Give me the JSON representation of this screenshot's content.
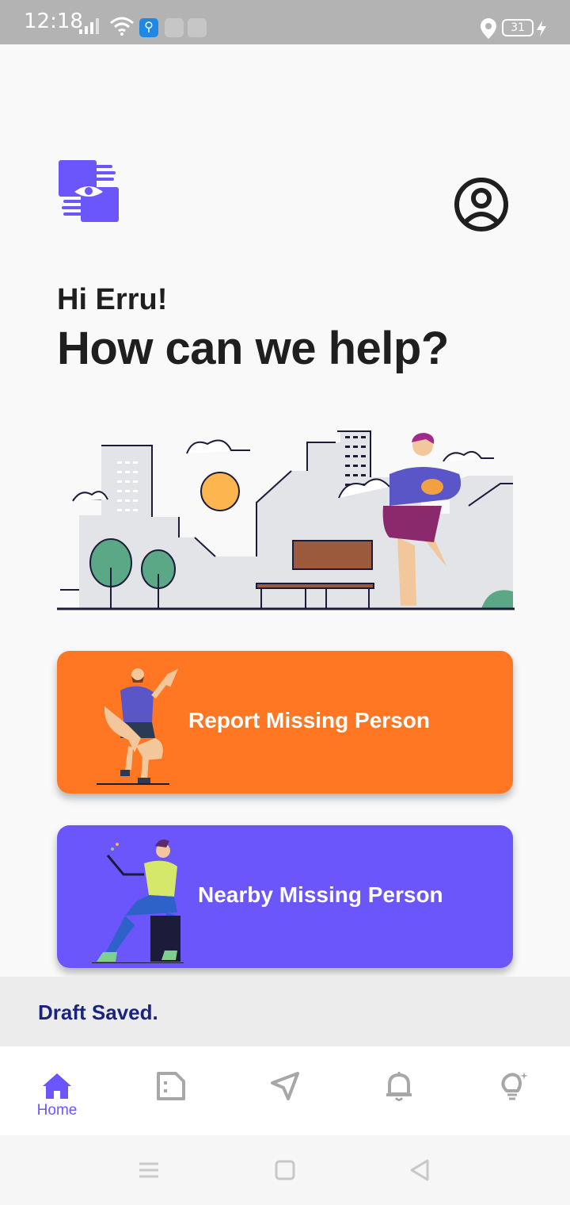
{
  "status_bar": {
    "time": "12:18",
    "battery_level": "31",
    "icons": [
      "signal-icon",
      "wifi-icon",
      "usb-icon",
      "app-icon",
      "app-icon",
      "location-icon",
      "battery-icon",
      "charging-icon"
    ]
  },
  "header": {
    "logo_icon": "hand-eye-logo",
    "profile_icon": "account-circle-icon"
  },
  "greeting": {
    "hello": "Hi Erru!",
    "question": "How can we help?"
  },
  "actions": {
    "report_label": "Report Missing Person",
    "nearby_label": "Nearby Missing Person"
  },
  "snackbar": {
    "message": "Draft Saved."
  },
  "bottom_nav": {
    "items": [
      {
        "icon": "home-icon",
        "label": "Home",
        "active": true
      },
      {
        "icon": "document-icon",
        "label": "",
        "active": false
      },
      {
        "icon": "send-icon",
        "label": "",
        "active": false
      },
      {
        "icon": "bell-icon",
        "label": "",
        "active": false
      },
      {
        "icon": "lightbulb-icon",
        "label": "",
        "active": false
      }
    ]
  },
  "colors": {
    "accent": "#6b56fb",
    "report_card": "#ff7722",
    "nearby_card": "#6b56fb",
    "snackbar_text": "#1a237e",
    "inactive_icon": "#a7a7a7"
  }
}
